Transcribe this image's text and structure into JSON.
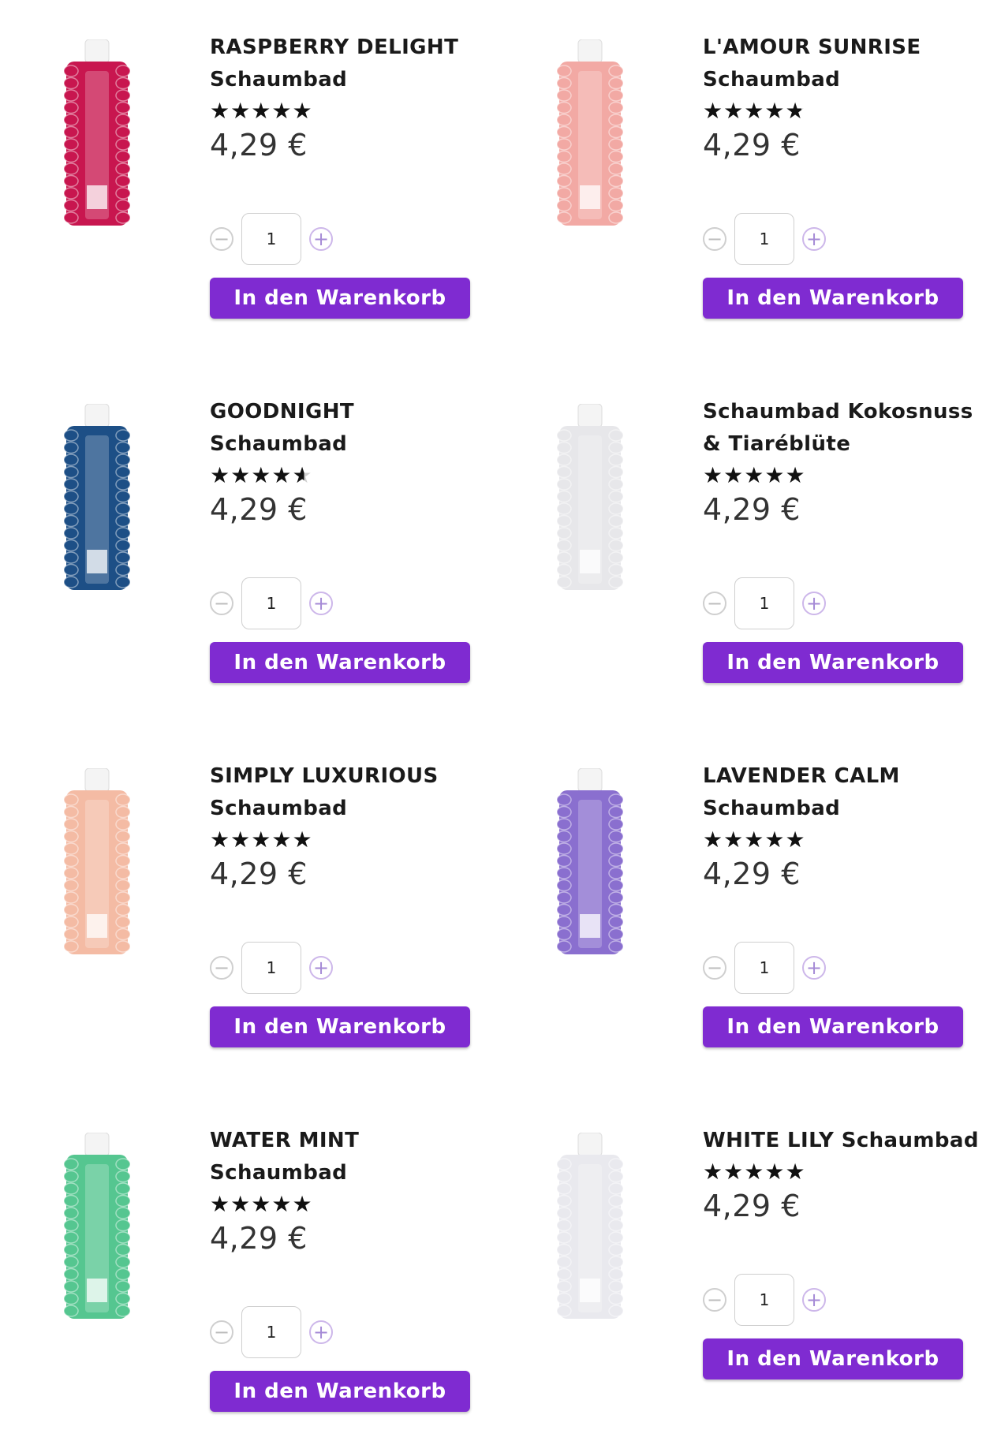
{
  "products": [
    {
      "name_line1": "RASPBERRY DELIGHT",
      "name_line2": "Schaumbad",
      "rating": 5,
      "price": "4,29 €",
      "quantity": "1",
      "cart_label": "In den Warenkorb",
      "bottle_color": "#c8164f",
      "cap_color": "#ffffff"
    },
    {
      "name_line1": "L'AMOUR SUNRISE",
      "name_line2": "Schaumbad",
      "rating": 4.8,
      "price": "4,29 €",
      "quantity": "1",
      "cart_label": "In den Warenkorb",
      "bottle_color": "#f2a9a4",
      "cap_color": "#ffffff"
    },
    {
      "name_line1": "GOODNIGHT Schaumbad",
      "name_line2": "",
      "rating": 4.6,
      "price": "4,29 €",
      "quantity": "1",
      "cart_label": "In den Warenkorb",
      "bottle_color": "#1d4f86",
      "cap_color": "#ffffff"
    },
    {
      "name_line1": "Schaumbad Kokosnuss",
      "name_line2": "& Tiaréblüte",
      "rating": 5,
      "price": "4,29 €",
      "quantity": "1",
      "cart_label": "In den Warenkorb",
      "bottle_color": "#e7e7ea",
      "cap_color": "#ffffff"
    },
    {
      "name_line1": "SIMPLY LUXURIOUS",
      "name_line2": "Schaumbad",
      "rating": 5,
      "price": "4,29 €",
      "quantity": "1",
      "cart_label": "In den Warenkorb",
      "bottle_color": "#f4bba4",
      "cap_color": "#ffffff"
    },
    {
      "name_line1": "LAVENDER CALM",
      "name_line2": "Schaumbad",
      "rating": 5,
      "price": "4,29 €",
      "quantity": "1",
      "cart_label": "In den Warenkorb",
      "bottle_color": "#8a6fcf",
      "cap_color": "#ffffff"
    },
    {
      "name_line1": "WATER MINT",
      "name_line2": "Schaumbad",
      "rating": 5,
      "price": "4,29 €",
      "quantity": "1",
      "cart_label": "In den Warenkorb",
      "bottle_color": "#55c690",
      "cap_color": "#ffffff"
    },
    {
      "name_line1": "WHITE LILY Schaumbad",
      "name_line2": "",
      "rating": 5,
      "price": "4,29 €",
      "quantity": "1",
      "cart_label": "In den Warenkorb",
      "bottle_color": "#e9e9ee",
      "cap_color": "#ffffff"
    }
  ],
  "colors": {
    "accent": "#7f2bd1",
    "minus_icon": "#bdbdbd",
    "plus_icon": "#a58ad6"
  },
  "icons": {
    "minus": "minus-circle-icon",
    "plus": "plus-circle-icon",
    "star": "star-icon"
  }
}
